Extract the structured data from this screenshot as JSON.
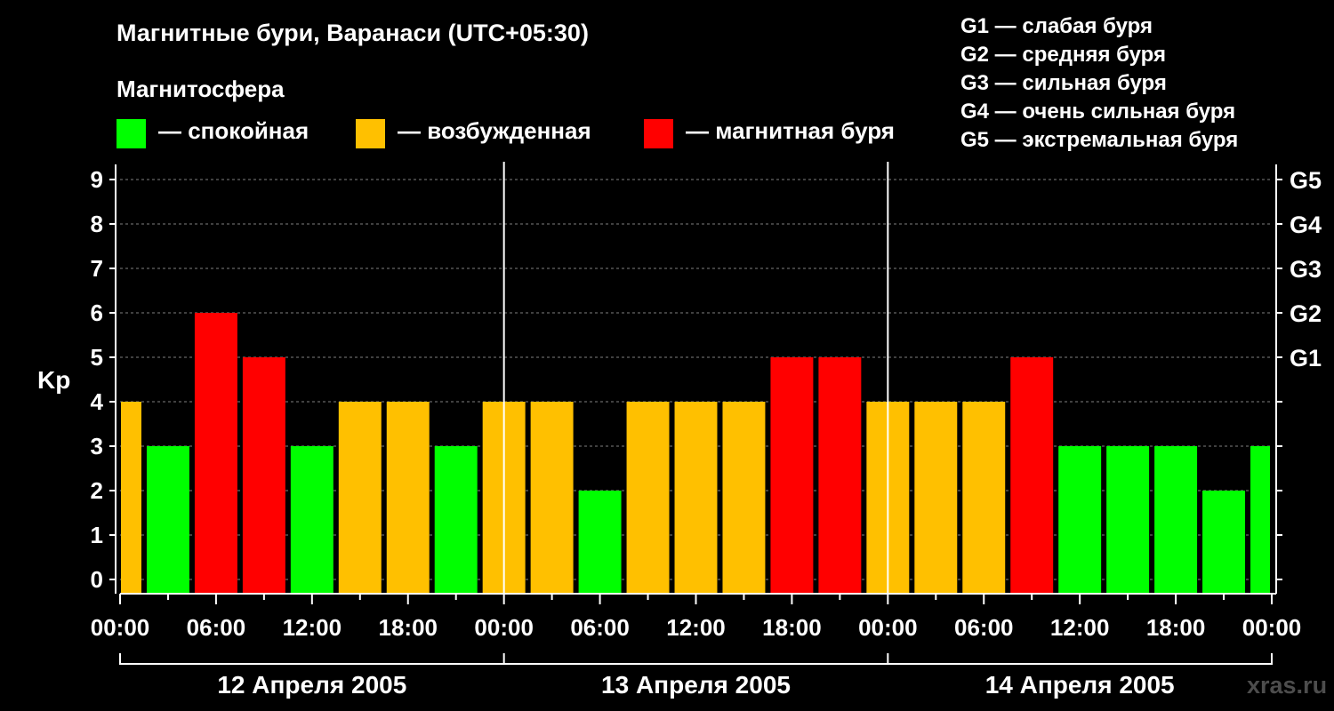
{
  "title": "Магнитные бури, Варанаси (UTC+05:30)",
  "subtitle": "Магнитосфера",
  "legend": [
    {
      "label": "— спокойная",
      "color": "#00ff00"
    },
    {
      "label": "— возбужденная",
      "color": "#ffc000"
    },
    {
      "label": "— магнитная буря",
      "color": "#ff0000"
    }
  ],
  "g_scale": [
    "G1 — слабая буря",
    "G2 — средняя буря",
    "G3 — сильная буря",
    "G4 — очень сильная буря",
    "G5 — экстремальная буря"
  ],
  "watermark": "xras.ru",
  "chart_data": {
    "type": "bar",
    "title": "Магнитные бури, Варанаси (UTC+05:30)",
    "ylabel": "Kp",
    "ylim": [
      0,
      9
    ],
    "yticks": [
      "0",
      "1",
      "2",
      "3",
      "4",
      "5",
      "6",
      "7",
      "8",
      "9"
    ],
    "right_ticks": [
      {
        "value": 5,
        "label": "G1"
      },
      {
        "value": 6,
        "label": "G2"
      },
      {
        "value": 7,
        "label": "G3"
      },
      {
        "value": 8,
        "label": "G4"
      },
      {
        "value": 9,
        "label": "G5"
      }
    ],
    "x_tick_labels": [
      "00:00",
      "06:00",
      "12:00",
      "18:00",
      "00:00",
      "06:00",
      "12:00",
      "18:00",
      "00:00",
      "06:00",
      "12:00",
      "18:00",
      "00:00"
    ],
    "days": [
      "12 Апреля 2005",
      "13 Апреля 2005",
      "14 Апреля 2005"
    ],
    "grid": true,
    "interval_hours": 3,
    "values": [
      4,
      3,
      6,
      5,
      3,
      4,
      4,
      3,
      4,
      4,
      2,
      4,
      4,
      4,
      5,
      5,
      4,
      4,
      4,
      5,
      3,
      3,
      3,
      2,
      3
    ],
    "colors": {
      "quiet": "#00ff00",
      "active": "#ffc000",
      "storm": "#ff0000"
    },
    "grid_color": "#808080"
  }
}
